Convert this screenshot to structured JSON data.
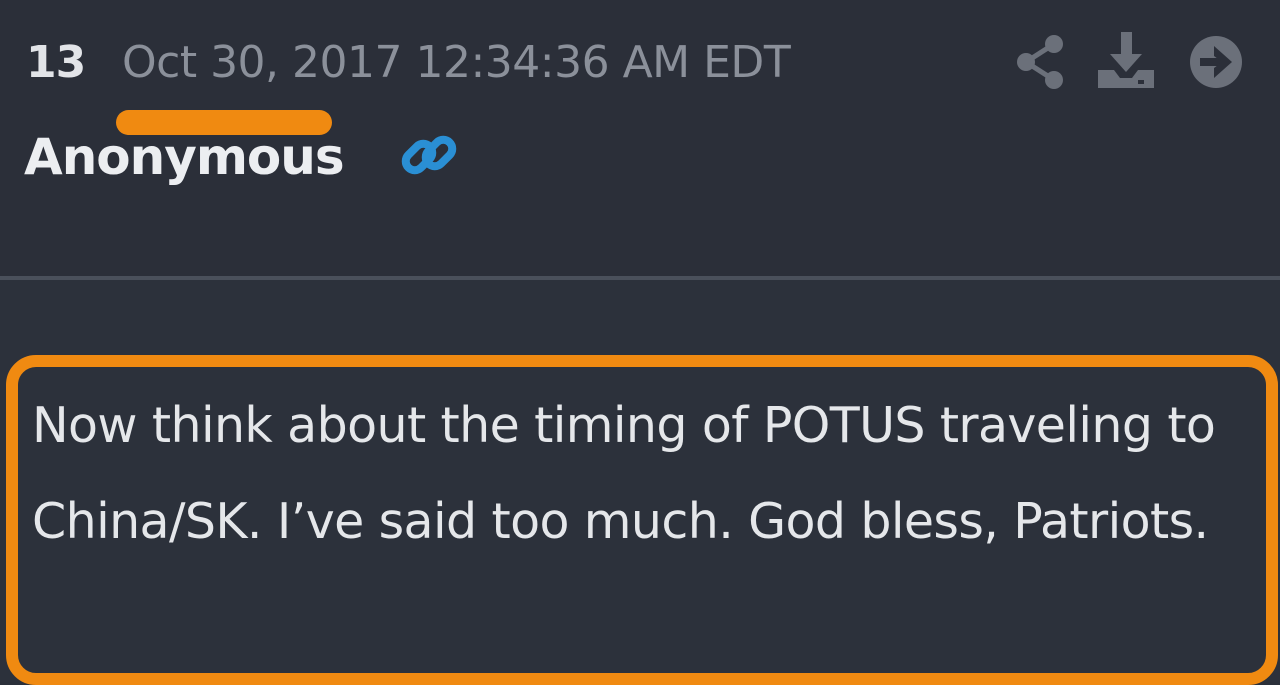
{
  "post": {
    "number": "13",
    "timestamp": "Oct 30, 2017 12:34:36 AM EDT",
    "author": "Anonymous",
    "body": "Now think about the timing of POTUS traveling to China/SK. I’ve said too much. God bless, Patriots."
  },
  "icons": {
    "link": "link-icon",
    "share": "share-icon",
    "download": "download-icon",
    "go": "arrow-right-circle-icon"
  },
  "colors": {
    "background": "#2b303a",
    "highlight": "#f08a11",
    "link_icon": "#2a8fd4",
    "muted_text": "#8b909a",
    "icon_gray": "#6b707a"
  }
}
